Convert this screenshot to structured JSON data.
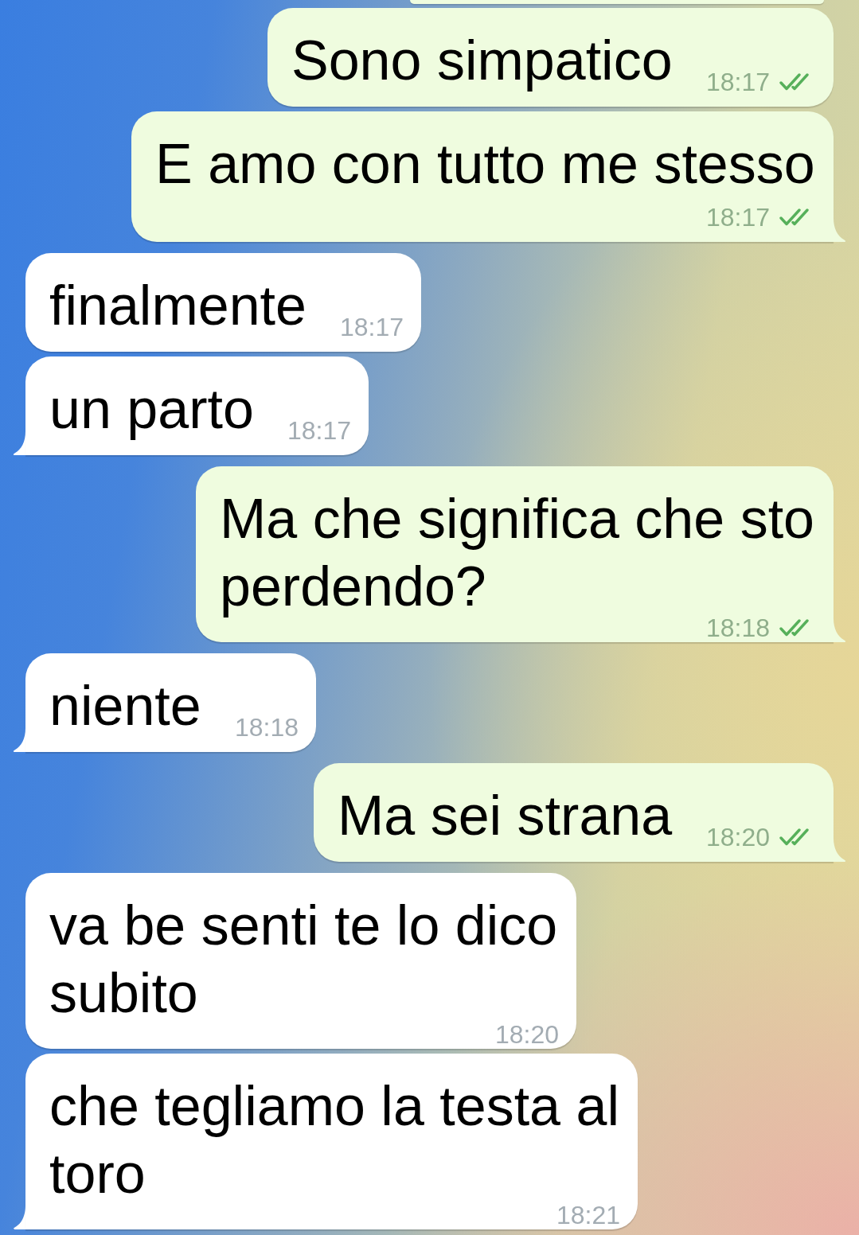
{
  "scrolled_bubble": {
    "kind": "outgoing"
  },
  "messages": [
    {
      "kind": "outgoing",
      "text": "Sono simpatico",
      "time": "18:17",
      "read": true,
      "tail": false
    },
    {
      "kind": "outgoing",
      "text": "E amo con tutto me stesso",
      "time": "18:17",
      "read": true,
      "tail": true
    },
    {
      "kind": "incoming",
      "text": "finalmente",
      "time": "18:17",
      "tail": false
    },
    {
      "kind": "incoming",
      "text": "un parto",
      "time": "18:17",
      "tail": true
    },
    {
      "kind": "outgoing",
      "text": "Ma che significa che sto perdendo?",
      "time": "18:18",
      "read": true,
      "tail": true
    },
    {
      "kind": "incoming",
      "text": "niente",
      "time": "18:18",
      "tail": true
    },
    {
      "kind": "outgoing",
      "text": "Ma sei strana",
      "time": "18:20",
      "read": true,
      "tail": true
    },
    {
      "kind": "incoming",
      "text": "va be senti te lo dico subito",
      "time": "18:20",
      "tail": false
    },
    {
      "kind": "incoming",
      "text": "che tegliamo la testa al toro",
      "time": "18:21",
      "tail": true
    }
  ]
}
